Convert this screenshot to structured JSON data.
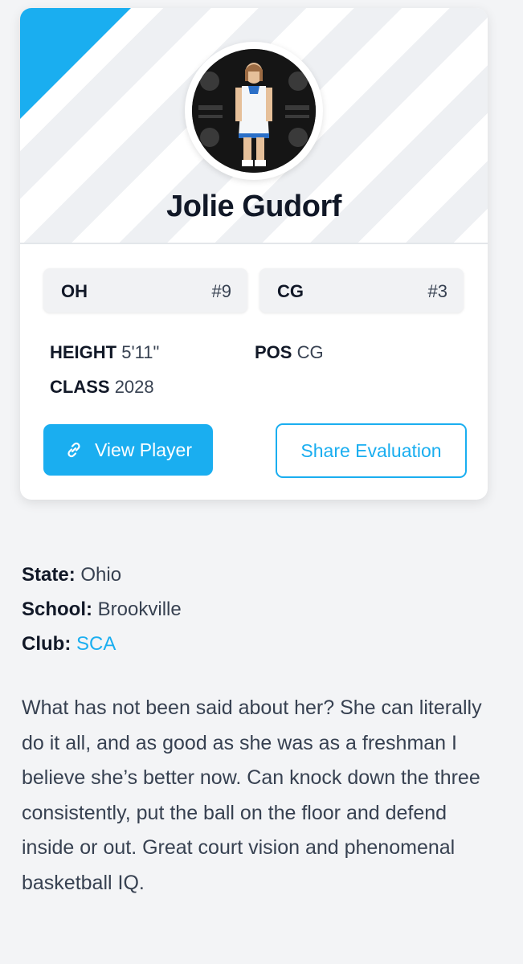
{
  "player": {
    "name": "Jolie Gudorf",
    "photo_alt": "Jolie Gudorf"
  },
  "positions": [
    {
      "pos": "OH",
      "number": "#9"
    },
    {
      "pos": "CG",
      "number": "#3"
    }
  ],
  "stats": {
    "height_label": "HEIGHT",
    "height_value": "5'11\"",
    "pos_label": "POS",
    "pos_value": "CG",
    "class_label": "CLASS",
    "class_value": "2028"
  },
  "actions": {
    "view_player": "View Player",
    "share_evaluation": "Share Evaluation"
  },
  "details": {
    "state_label": "State:",
    "state_value": "Ohio",
    "school_label": "School:",
    "school_value": "Brookville",
    "club_label": "Club:",
    "club_value": "SCA"
  },
  "bio": "What has not been said about her? She can literally do it all, and as good as she was as a freshman I believe she’s better now. Can knock down the three consistently, put the ball on the floor and defend inside or out. Great court vision and phenomenal basketball IQ.",
  "colors": {
    "accent": "#1aaef0",
    "background": "#f3f4f6",
    "card": "#ffffff"
  }
}
